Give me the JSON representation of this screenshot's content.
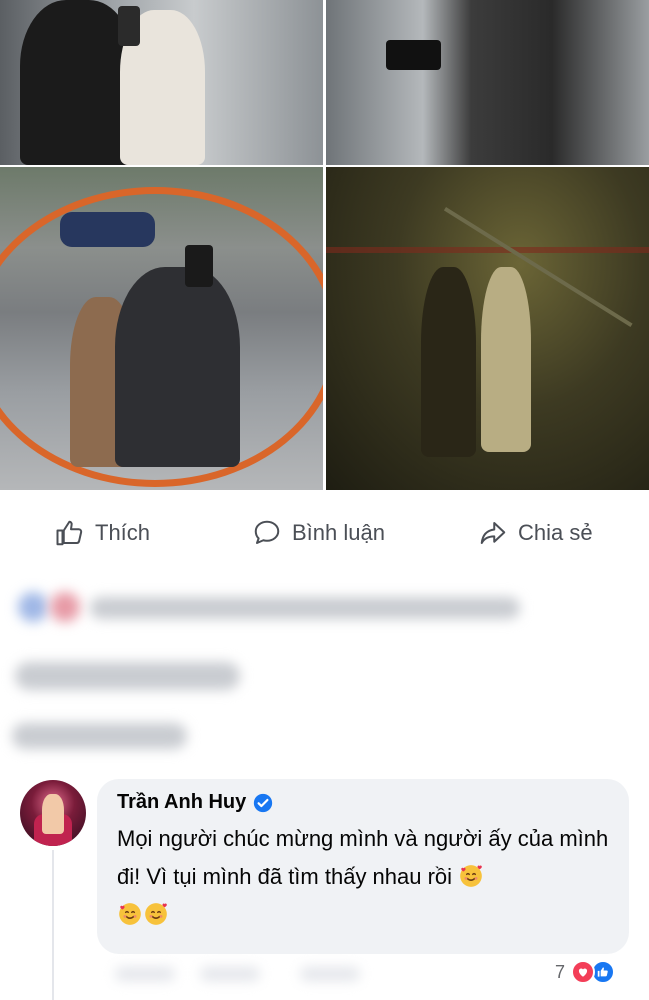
{
  "post": {
    "photos": [
      {
        "caption": ""
      },
      {
        "caption": ""
      },
      {
        "caption": ""
      },
      {
        "caption": ""
      }
    ]
  },
  "actions": {
    "like_label": "Thích",
    "comment_label": "Bình luận",
    "share_label": "Chia sẻ"
  },
  "comment": {
    "author": "Trần Anh Huy",
    "verified": true,
    "text": "Mọi người chúc mừng mình và người ấy của mình đi! Vì tụi mình đã tìm thấy nhau rồi",
    "emoji": "smiling-face-with-hearts",
    "reaction_count": "7"
  },
  "colors": {
    "icon_gray": "#4b4f56",
    "bubble_bg": "#f0f2f5",
    "verified_blue": "#1877f2",
    "love_red": "#f33e58"
  }
}
